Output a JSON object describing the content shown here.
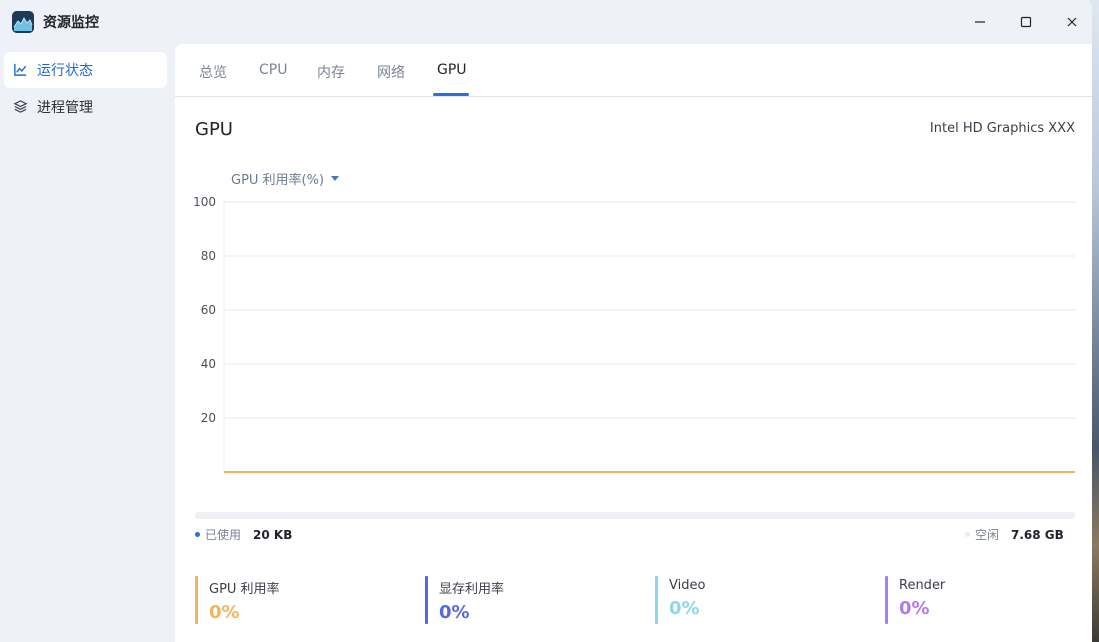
{
  "app": {
    "title": "资源监控"
  },
  "sidebar": {
    "items": [
      {
        "label": "运行状态",
        "icon": "line-chart-icon",
        "active": true
      },
      {
        "label": "进程管理",
        "icon": "layers-icon",
        "active": false
      }
    ]
  },
  "tabs": [
    {
      "label": "总览"
    },
    {
      "label": "CPU"
    },
    {
      "label": "内存"
    },
    {
      "label": "网络"
    },
    {
      "label": "GPU",
      "active": true
    }
  ],
  "section": {
    "title": "GPU",
    "device": "Intel HD Graphics XXX"
  },
  "metric": {
    "selected": "GPU 利用率(%)"
  },
  "chart_data": {
    "type": "line",
    "ylim": [
      0,
      100
    ],
    "yticks": [
      20,
      40,
      60,
      80,
      100
    ],
    "series": [
      {
        "values": [
          0,
          0,
          0,
          0,
          0,
          0,
          0,
          0,
          0,
          0
        ],
        "color": "#f2b55d"
      }
    ],
    "grid": true
  },
  "usage": {
    "used_label": "已使用",
    "used_value": "20 KB",
    "used_color": "#2b6fd8",
    "free_label": "空闲",
    "free_value": "7.68 GB",
    "free_color": "#e9ecf1"
  },
  "stats": [
    {
      "label": "GPU 利用率",
      "value": "0%",
      "color": "#f2b55d"
    },
    {
      "label": "显存利用率",
      "value": "0%",
      "color": "#5667e0"
    },
    {
      "label": "Video",
      "value": "0%",
      "color": "#8ed6ea"
    },
    {
      "label": "Render",
      "value": "0%",
      "color": "#b07cea"
    }
  ]
}
